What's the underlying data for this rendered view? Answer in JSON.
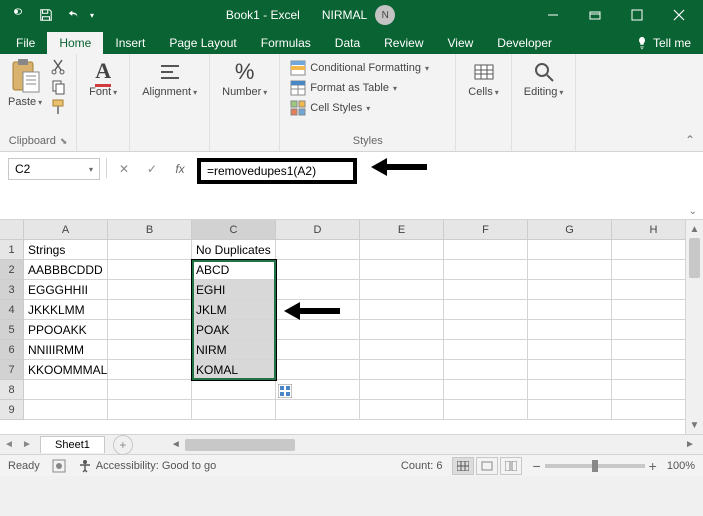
{
  "titlebar": {
    "app_title": "Book1 - Excel",
    "user_name": "NIRMAL",
    "user_initial": "N"
  },
  "tabs": {
    "file": "File",
    "home": "Home",
    "insert": "Insert",
    "page_layout": "Page Layout",
    "formulas": "Formulas",
    "data": "Data",
    "review": "Review",
    "view": "View",
    "developer": "Developer",
    "tell_me": "Tell me"
  },
  "ribbon": {
    "clipboard": {
      "label": "Clipboard",
      "paste": "Paste"
    },
    "font": {
      "label": "Font"
    },
    "alignment": {
      "label": "Alignment"
    },
    "number": {
      "label": "Number"
    },
    "styles": {
      "label": "Styles",
      "cond_format": "Conditional Formatting",
      "format_table": "Format as Table",
      "cell_styles": "Cell Styles"
    },
    "cells": {
      "label": "Cells"
    },
    "editing": {
      "label": "Editing"
    }
  },
  "formula_bar": {
    "name_box": "C2",
    "formula": "=removedupes1(A2)"
  },
  "columns": [
    "A",
    "B",
    "C",
    "D",
    "E",
    "F",
    "G",
    "H"
  ],
  "rows": [
    "1",
    "2",
    "3",
    "4",
    "5",
    "6",
    "7",
    "8",
    "9"
  ],
  "cells": {
    "A1": "Strings",
    "C1": "No Duplicates",
    "A2": "AABBBCDDD",
    "C2": "ABCD",
    "A3": "EGGGHHII",
    "C3": "EGHI",
    "A4": "JKKKLMM",
    "C4": "JKLM",
    "A5": "PPOOAKK",
    "C5": "POAK",
    "A6": "NNIIIRMM",
    "C6": "NIRM",
    "A7": "KKOOMMMAL",
    "C7": "KOMAL"
  },
  "sheet": {
    "name": "Sheet1"
  },
  "status": {
    "ready": "Ready",
    "accessibility": "Accessibility: Good to go",
    "count_label": "Count: 6",
    "zoom": "100%"
  }
}
